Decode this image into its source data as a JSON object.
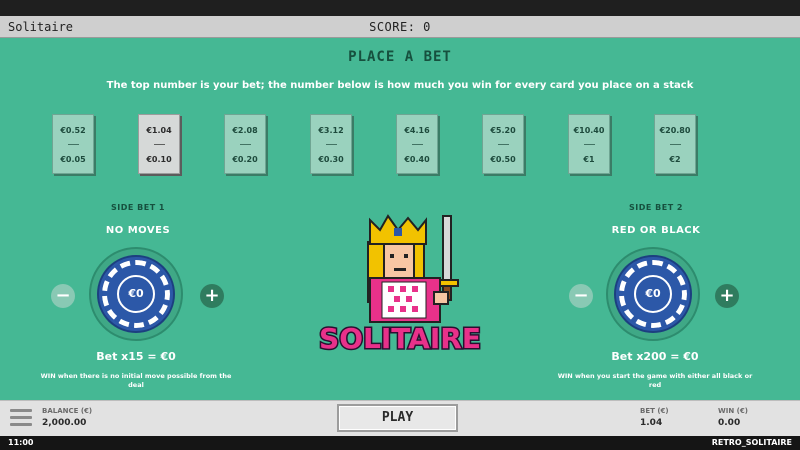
{
  "app": {
    "title": "Solitaire",
    "score_label": "SCORE: 0"
  },
  "heading": "PLACE A BET",
  "subtitle": "The top number is your bet; the number below is how much you win for every card you place on a stack",
  "bets": [
    {
      "amount": "€0.52",
      "win": "€0.05",
      "selected": false
    },
    {
      "amount": "€1.04",
      "win": "€0.10",
      "selected": true
    },
    {
      "amount": "€2.08",
      "win": "€0.20",
      "selected": false
    },
    {
      "amount": "€3.12",
      "win": "€0.30",
      "selected": false
    },
    {
      "amount": "€4.16",
      "win": "€0.40",
      "selected": false
    },
    {
      "amount": "€5.20",
      "win": "€0.50",
      "selected": false
    },
    {
      "amount": "€10.40",
      "win": "€1",
      "selected": false
    },
    {
      "amount": "€20.80",
      "win": "€2",
      "selected": false
    }
  ],
  "side_bet_1": {
    "label": "SIDE BET 1",
    "title": "NO MOVES",
    "chip_value": "€0",
    "minus": "−",
    "plus": "+",
    "multiplier": "Bet x15 = €0",
    "description": "WIN when there is no initial move possible from the deal"
  },
  "side_bet_2": {
    "label": "SIDE BET 2",
    "title": "RED OR BLACK",
    "chip_value": "€0",
    "minus": "−",
    "plus": "+",
    "multiplier": "Bet x200 = €0",
    "description": "WIN when you start the game with either all black or red"
  },
  "logo": {
    "text": "SOLITAIRE",
    "icon": "king-icon"
  },
  "footer": {
    "balance_label": "BALANCE (€)",
    "balance_value": "2,000.00",
    "play_label": "PLAY",
    "bet_label": "BET (€)",
    "bet_value": "1.04",
    "win_label": "WIN (€)",
    "win_value": "0.00"
  },
  "status": {
    "clock": "11:00",
    "game_id": "RETRO_SOLITAIRE"
  },
  "colors": {
    "background": "#45b894",
    "chip": "#2c58a8",
    "plus_button": "#2f7c5f",
    "minus_button": "#89c9b4",
    "bet_card": "#9ad2be",
    "bet_card_selected": "#d6d9d8",
    "logo_pink": "#e8318a"
  }
}
